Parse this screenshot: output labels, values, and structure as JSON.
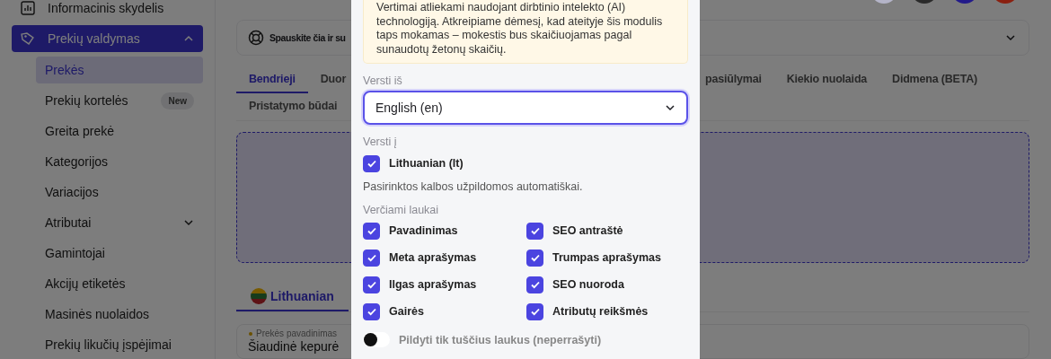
{
  "sidebar": {
    "items": [
      {
        "label": "Informacinis skydelis",
        "selected": false
      },
      {
        "label": "Prekių valdymas",
        "selected": true,
        "expanded": true,
        "children": [
          {
            "label": "Prekės",
            "selected": true
          },
          {
            "label": "Prekių kortelės",
            "selected": false,
            "badge": "New"
          },
          {
            "label": "Greita prekė",
            "selected": false
          },
          {
            "label": "Kategorijos",
            "selected": false
          },
          {
            "label": "Variacijos",
            "selected": false
          },
          {
            "label": "Atributai",
            "selected": false,
            "expanded": false
          },
          {
            "label": "Gamintojai",
            "selected": false
          },
          {
            "label": "Akcijų etiketės",
            "selected": false
          },
          {
            "label": "Masinės nuolaidos",
            "selected": false
          },
          {
            "label": "Prekių likučių įspėjimai",
            "selected": false
          }
        ]
      }
    ]
  },
  "header": {
    "avatars": [
      {
        "color": "#b4b4c8"
      },
      {
        "color": "#2a2a2a"
      },
      {
        "color": "#221a8a"
      },
      {
        "color": "#8a2010"
      }
    ]
  },
  "help_bar": {
    "text": "Spauskite čia ir su",
    "expanded": false
  },
  "tabs": [
    {
      "label": "Bendrieji",
      "selected": true
    },
    {
      "label": "Duor",
      "selected": false
    },
    {
      "label": "pasiūlymai",
      "selected": false
    },
    {
      "label": "Kiekio nuolaida",
      "selected": false
    },
    {
      "label": "Didmena (BETA)",
      "selected": false
    },
    {
      "label": "Pristatymo būdai",
      "selected": false
    }
  ],
  "language_tabs": [
    {
      "label": "Lithuanian",
      "selected": true
    }
  ],
  "name_field": {
    "label": "Prekės pavadinimas",
    "required": true,
    "value": "Šiaudinė kepurė"
  },
  "modal": {
    "notice": "Vertimai atliekami naudojant dirbtinio intelekto (AI) technologiją. Atkreipiame dėmesį, kad ateityje šis modulis taps mokamas – mokestis bus skaičiuojamas pagal sunaudotų žetonų skaičių.",
    "from": {
      "label": "Versti iš",
      "value": "English (en)"
    },
    "to": {
      "label": "Versti į",
      "options": [
        {
          "label": "Lithuanian (lt)",
          "checked": true
        }
      ]
    },
    "hint": "Pasirinktos kalbos užpildomos automatiškai.",
    "fields": {
      "label": "Verčiami laukai",
      "items": [
        {
          "label": "Pavadinimas",
          "checked": true
        },
        {
          "label": "SEO antraštė",
          "checked": true
        },
        {
          "label": "Meta aprašymas",
          "checked": true
        },
        {
          "label": "Trumpas aprašymas",
          "checked": true
        },
        {
          "label": "Ilgas aprašymas",
          "checked": true
        },
        {
          "label": "SEO nuoroda",
          "checked": true
        },
        {
          "label": "Gairės",
          "checked": true
        },
        {
          "label": "Atributų reikšmės",
          "checked": true
        }
      ]
    },
    "toggle": {
      "label": "Pildyti tik tuščius laukus (neperrašyti)",
      "on": false
    }
  }
}
